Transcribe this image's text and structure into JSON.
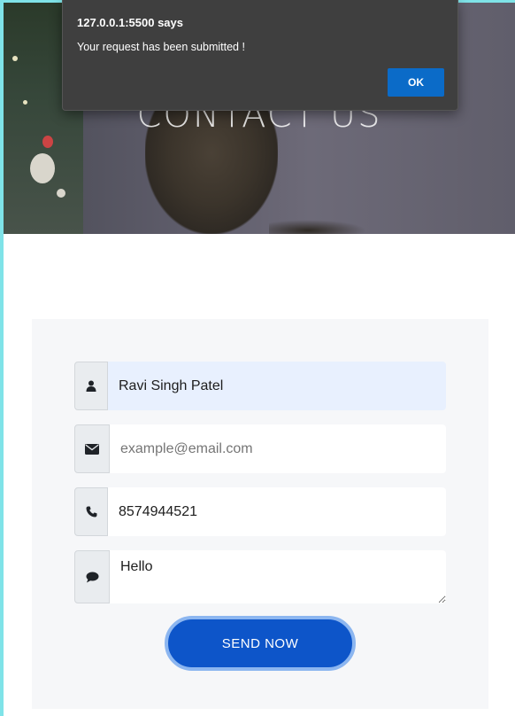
{
  "dialog": {
    "title": "127.0.0.1:5500 says",
    "message": "Your request has been submitted !",
    "ok_label": "OK"
  },
  "hero": {
    "title": "CONTACT US"
  },
  "form": {
    "name_value": "Ravi Singh Patel",
    "email_placeholder": "example@email.com",
    "phone_value": "8574944521",
    "message_value": "Hello",
    "send_label": "SEND NOW"
  },
  "colors": {
    "accent": "#0d55c9",
    "dialog_ok": "#0b6bc8",
    "card_bg": "#f6f7f9"
  }
}
